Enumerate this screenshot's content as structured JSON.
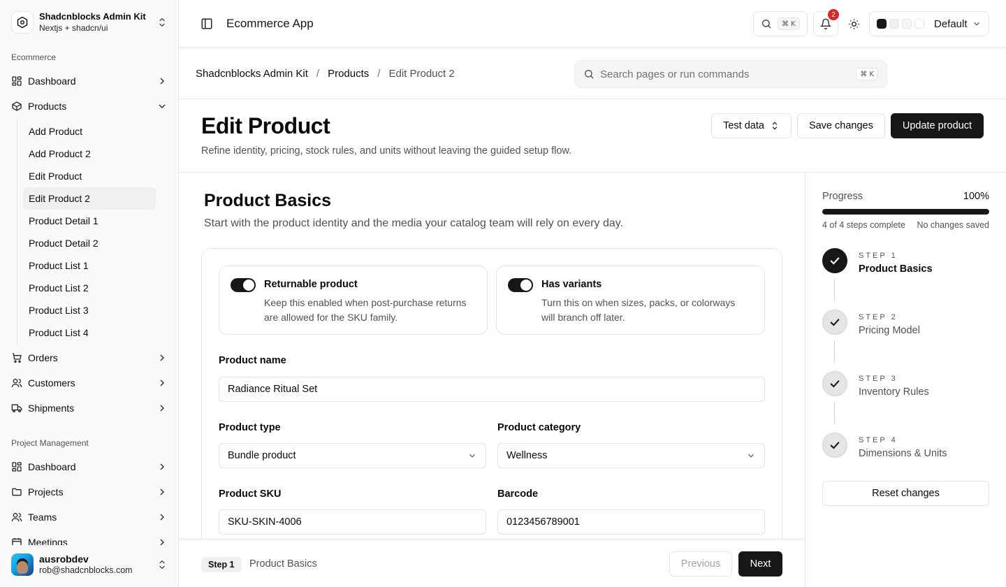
{
  "sidebar": {
    "team": {
      "name": "Shadcnblocks Admin Kit",
      "subtitle": "Nextjs + shadcn/ui"
    },
    "groups": [
      {
        "label": "Ecommerce",
        "items": [
          {
            "label": "Dashboard",
            "icon": "layout-dashboard-icon"
          },
          {
            "label": "Products",
            "icon": "package-icon",
            "expanded": true,
            "sub": [
              "Add Product",
              "Add Product 2",
              "Edit Product",
              "Edit Product 2",
              "Product Detail 1",
              "Product Detail 2",
              "Product List 1",
              "Product List 2",
              "Product List 3",
              "Product List 4"
            ],
            "active_sub": "Edit Product 2"
          },
          {
            "label": "Orders",
            "icon": "cart-icon"
          },
          {
            "label": "Customers",
            "icon": "users-icon"
          },
          {
            "label": "Shipments",
            "icon": "truck-icon"
          }
        ]
      },
      {
        "label": "Project Management",
        "items": [
          {
            "label": "Dashboard",
            "icon": "layout-dashboard-icon"
          },
          {
            "label": "Projects",
            "icon": "folder-icon"
          },
          {
            "label": "Teams",
            "icon": "users-icon"
          },
          {
            "label": "Meetings",
            "icon": "calendar-icon"
          }
        ]
      }
    ],
    "user": {
      "name": "ausrobdev",
      "email": "rob@shadcnblocks.com"
    }
  },
  "header": {
    "app_title": "Ecommerce App",
    "search_shortcut": "⌘ K",
    "notification_count": "2",
    "theme_label": "Default",
    "theme_swatches": [
      "#171717",
      "#f0f0f0",
      "#f5f5f5",
      "#ffffff"
    ]
  },
  "breadcrumb": {
    "items": [
      "Shadcnblocks Admin Kit",
      "Products",
      "Edit Product 2"
    ],
    "search_placeholder": "Search pages or run commands",
    "search_shortcut": "⌘ K"
  },
  "page": {
    "title": "Edit Product",
    "description": "Refine identity, pricing, stock rules, and units without leaving the guided setup flow.",
    "actions": {
      "test_data": "Test data",
      "save": "Save changes",
      "update": "Update product"
    }
  },
  "form": {
    "section_title": "Product Basics",
    "section_desc": "Start with the product identity and the media your catalog team will rely on every day.",
    "toggles": [
      {
        "title": "Returnable product",
        "desc": "Keep this enabled when post-purchase returns are allowed for the SKU family.",
        "on": true
      },
      {
        "title": "Has variants",
        "desc": "Turn this on when sizes, packs, or colorways will branch off later.",
        "on": true
      }
    ],
    "product_name": {
      "label": "Product name",
      "value": "Radiance Ritual Set"
    },
    "product_type": {
      "label": "Product type",
      "value": "Bundle product"
    },
    "product_category": {
      "label": "Product category",
      "value": "Wellness"
    },
    "product_sku": {
      "label": "Product SKU",
      "value": "SKU-SKIN-4006"
    },
    "barcode": {
      "label": "Barcode",
      "value": "0123456789001"
    }
  },
  "footer": {
    "step_pill": "Step 1",
    "step_name": "Product Basics",
    "previous": "Previous",
    "next": "Next"
  },
  "progress": {
    "label": "Progress",
    "value_text": "100%",
    "value": 1.0,
    "steps_complete": "4 of 4 steps complete",
    "saved_status": "No changes saved",
    "steps": [
      {
        "kicker": "STEP 1",
        "title": "Product Basics",
        "active": true
      },
      {
        "kicker": "STEP 2",
        "title": "Pricing Model"
      },
      {
        "kicker": "STEP 3",
        "title": "Inventory Rules"
      },
      {
        "kicker": "STEP 4",
        "title": "Dimensions & Units"
      }
    ],
    "reset": "Reset changes"
  }
}
